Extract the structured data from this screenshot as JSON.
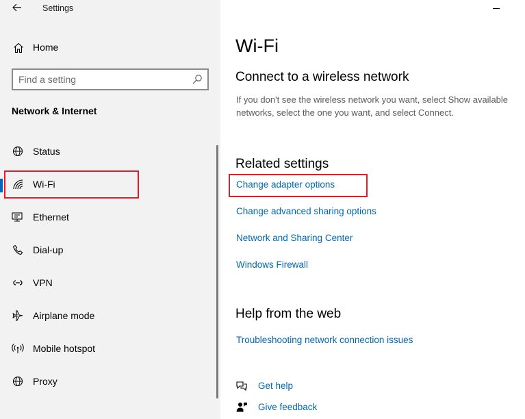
{
  "window": {
    "title": "Settings",
    "back_icon": "back-arrow-icon"
  },
  "sidebar": {
    "home_label": "Home",
    "home_icon": "home-icon",
    "search": {
      "placeholder": "Find a setting",
      "value": "",
      "icon": "search-icon"
    },
    "section_heading": "Network & Internet",
    "items": [
      {
        "label": "Status",
        "icon": "globe-icon",
        "selected": false
      },
      {
        "label": "Wi-Fi",
        "icon": "wifi-icon",
        "selected": true
      },
      {
        "label": "Ethernet",
        "icon": "ethernet-icon",
        "selected": false
      },
      {
        "label": "Dial-up",
        "icon": "phone-icon",
        "selected": false
      },
      {
        "label": "VPN",
        "icon": "vpn-icon",
        "selected": false
      },
      {
        "label": "Airplane mode",
        "icon": "airplane-icon",
        "selected": false
      },
      {
        "label": "Mobile hotspot",
        "icon": "hotspot-icon",
        "selected": false
      },
      {
        "label": "Proxy",
        "icon": "globe-icon",
        "selected": false
      }
    ]
  },
  "main": {
    "title": "Wi-Fi",
    "connect_heading": "Connect to a wireless network",
    "connect_desc_line1": "If you don't see the wireless network you want, select Show available",
    "connect_desc_line2": "networks, select the one you want, and select Connect.",
    "related_heading": "Related settings",
    "related_links": [
      "Change adapter options",
      "Change advanced sharing options",
      "Network and Sharing Center",
      "Windows Firewall"
    ],
    "help_heading": "Help from the web",
    "help_links": [
      "Troubleshooting network connection issues"
    ],
    "bottom_links": [
      {
        "label": "Get help",
        "icon": "help-chat-icon"
      },
      {
        "label": "Give feedback",
        "icon": "feedback-icon"
      }
    ]
  },
  "colors": {
    "accent": "#0067c0",
    "link": "#0066b4",
    "annotation_red": "#e01e2b",
    "sidebar_bg": "#f2f2f2"
  }
}
